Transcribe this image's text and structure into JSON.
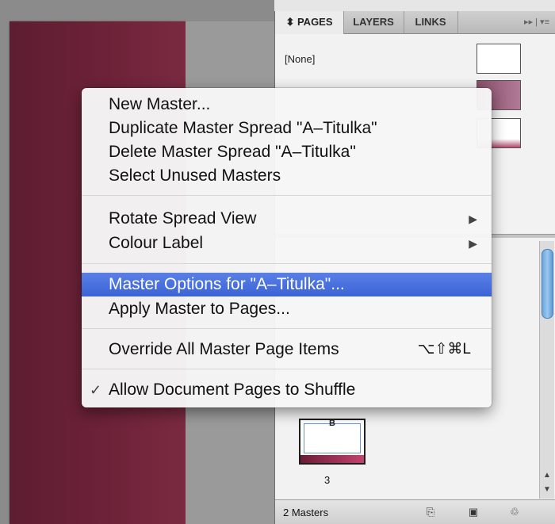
{
  "panel": {
    "tabs": [
      {
        "label": "⬍ PAGES"
      },
      {
        "label": "LAYERS"
      },
      {
        "label": "LINKS"
      }
    ],
    "controls": "▸▸  |  ▾≡",
    "none_label": "[None]",
    "page_thumb_letter": "B",
    "page_number": "3",
    "status_text": "2 Masters",
    "scroll_up": "▲",
    "scroll_down": "▼"
  },
  "icons": {
    "new_master": "⎘",
    "new_page": "▣",
    "trash": "♲"
  },
  "menu": {
    "items": [
      {
        "label": "New Master..."
      },
      {
        "label": "Duplicate Master Spread \"A–Titulka\""
      },
      {
        "label": "Delete Master Spread \"A–Titulka\""
      },
      {
        "label": "Select Unused Masters"
      },
      {
        "label": "Rotate Spread View",
        "arrow": "▶"
      },
      {
        "label": "Colour Label",
        "arrow": "▶"
      },
      {
        "label": "Master Options for \"A–Titulka\"..."
      },
      {
        "label": "Apply Master to Pages..."
      },
      {
        "label": "Override All Master Page Items",
        "shortcut": "⌥⇧⌘L"
      },
      {
        "label": "Allow Document Pages to Shuffle",
        "check": "✓"
      }
    ]
  },
  "colors": {
    "document_page": "#6d2238",
    "menu_highlight": "#3a63d6"
  }
}
